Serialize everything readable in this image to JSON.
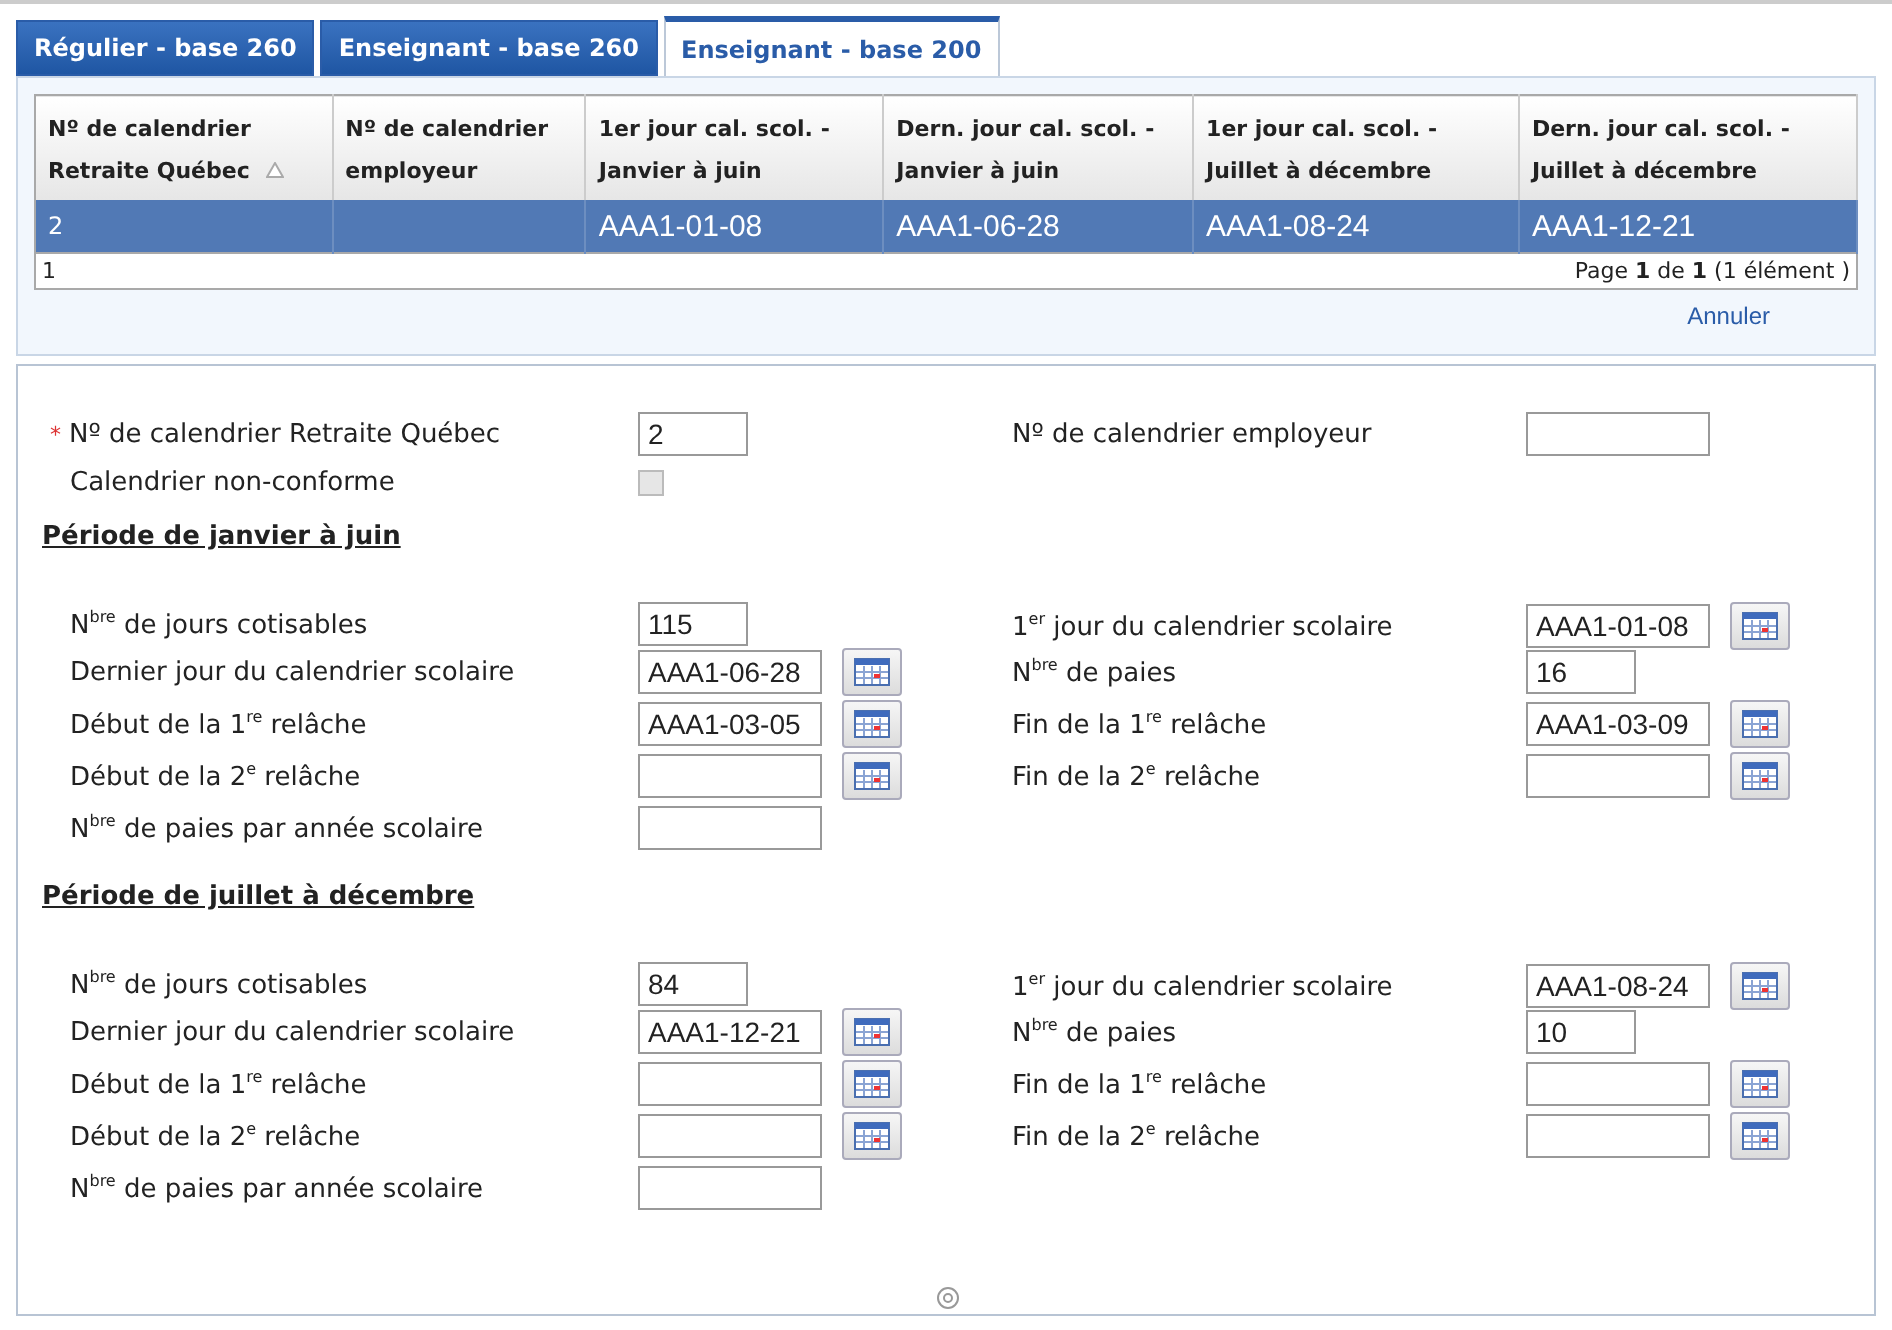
{
  "tabs": [
    {
      "label": "Régulier - base 260",
      "selected": false
    },
    {
      "label": "Enseignant - base 260",
      "selected": false
    },
    {
      "label": "Enseignant - base 200",
      "selected": true
    }
  ],
  "table": {
    "columns": [
      {
        "label": "Nº de calendrier Retraite Québec",
        "sorted": true
      },
      {
        "label": "Nº de calendrier employeur",
        "sorted": false
      },
      {
        "label": "1er jour cal. scol. - Janvier à juin",
        "sorted": false
      },
      {
        "label": "Dern. jour cal. scol. - Janvier à juin",
        "sorted": false
      },
      {
        "label": "1er jour cal. scol. - Juillet à décembre",
        "sorted": false
      },
      {
        "label": "Dern. jour cal. scol. - Juillet à décembre",
        "sorted": false
      }
    ],
    "rows": [
      {
        "selected": true,
        "cells": [
          "2",
          null,
          "AAA1-01-08",
          "AAA1-06-28",
          "AAA1-08-24",
          "AAA1-12-21"
        ]
      }
    ],
    "footer_count": "1",
    "pager": "Page **1** de **1** (1  élément )"
  },
  "cancel_link": "Annuler",
  "form": {
    "header_left": {
      "required_mark": "*",
      "label": "Nº de calendrier Retraite Québec",
      "value": "2"
    },
    "header_right": {
      "label": "Nº de calendrier employeur"
    },
    "checkbox": {
      "label": "Calendrier non-conforme",
      "checked": false,
      "disabled": true
    },
    "periods": [
      {
        "title": "Période de janvier à juin",
        "left": [
          {
            "kind": "short",
            "label": "N$^{bre}$ de jours cotisables",
            "value": "115"
          },
          {
            "kind": "date",
            "label": "Dernier jour du calendrier scolaire",
            "value": "AAA1-06-28"
          },
          {
            "kind": "date",
            "label": "Début de la 1$^{re}$ relâche",
            "value": "AAA1-03-05"
          },
          {
            "kind": "date",
            "label": "Début de la 2$^{e}$ relâche"
          },
          {
            "kind": "long",
            "label": "N$^{bre}$ de paies par année scolaire"
          }
        ],
        "right": [
          {
            "kind": "date",
            "label": "1$^{er}$ jour du calendrier scolaire",
            "value": "AAA1-01-08"
          },
          {
            "kind": "short",
            "label": "N$^{bre}$ de paies",
            "value": "16"
          },
          {
            "kind": "date",
            "label": "Fin de la 1$^{re}$ relâche",
            "value": "AAA1-03-09"
          },
          {
            "kind": "date",
            "label": "Fin de la 2$^{e}$ relâche"
          }
        ]
      },
      {
        "title": "Période de juillet à décembre",
        "left": [
          {
            "kind": "short",
            "label": "N$^{bre}$ de jours cotisables",
            "value": "84"
          },
          {
            "kind": "date",
            "label": "Dernier jour du calendrier scolaire",
            "value": "AAA1-12-21"
          },
          {
            "kind": "date",
            "label": "Début de la 1$^{re}$ relâche"
          },
          {
            "kind": "date",
            "label": "Début de la 2$^{e}$ relâche"
          },
          {
            "kind": "long",
            "label": "N$^{bre}$ de paies par année scolaire"
          }
        ],
        "right": [
          {
            "kind": "date",
            "label": "1$^{er}$ jour du calendrier scolaire",
            "value": "AAA1-08-24"
          },
          {
            "kind": "short",
            "label": "N$^{bre}$ de paies",
            "value": "10"
          },
          {
            "kind": "date",
            "label": "Fin de la 1$^{re}$ relâche"
          },
          {
            "kind": "date",
            "label": "Fin de la 2$^{e}$ relâche"
          }
        ]
      }
    ]
  }
}
